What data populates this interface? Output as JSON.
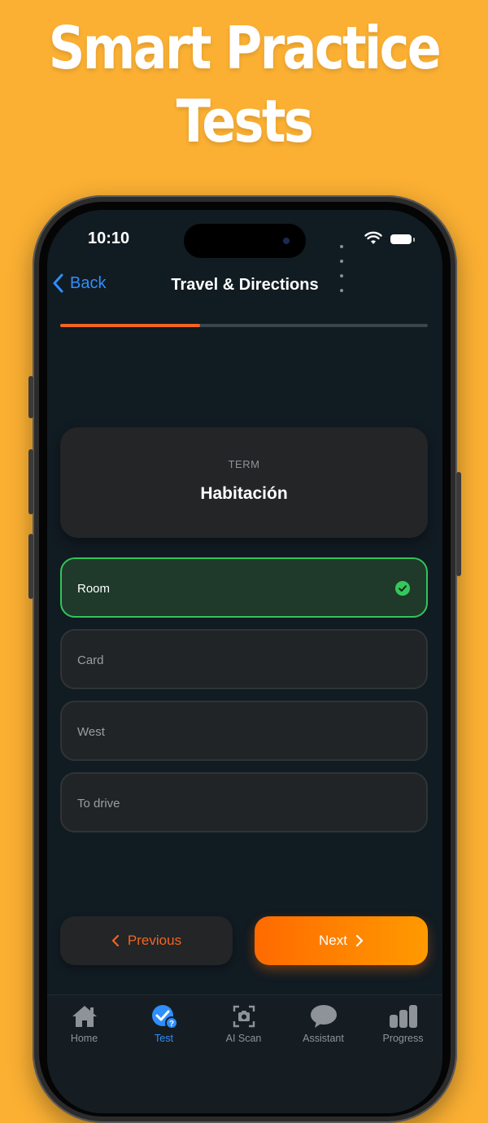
{
  "headline": {
    "line1": "Smart Practice",
    "line2": "Tests"
  },
  "status_bar": {
    "time": "10:10"
  },
  "nav": {
    "back_label": "Back",
    "title": "Travel & Directions"
  },
  "progress": {
    "fraction": 0.38
  },
  "term_card": {
    "label": "TERM",
    "word": "Habitación"
  },
  "options": [
    {
      "label": "Room",
      "state": "correct"
    },
    {
      "label": "Card",
      "state": "default"
    },
    {
      "label": "West",
      "state": "default"
    },
    {
      "label": "To drive",
      "state": "default"
    }
  ],
  "buttons": {
    "previous": "Previous",
    "next": "Next"
  },
  "tabbar": {
    "items": [
      {
        "label": "Home",
        "icon": "home-icon"
      },
      {
        "label": "Test",
        "icon": "test-check-icon",
        "active": true
      },
      {
        "label": "AI Scan",
        "icon": "camera-scan-icon"
      },
      {
        "label": "Assistant",
        "icon": "chat-bubble-icon"
      },
      {
        "label": "Progress",
        "icon": "bar-chart-icon"
      }
    ]
  },
  "colors": {
    "background": "#fbb033",
    "accent_orange": "#ff7a00",
    "correct_green": "#34c759",
    "link_blue": "#2e8fff"
  }
}
